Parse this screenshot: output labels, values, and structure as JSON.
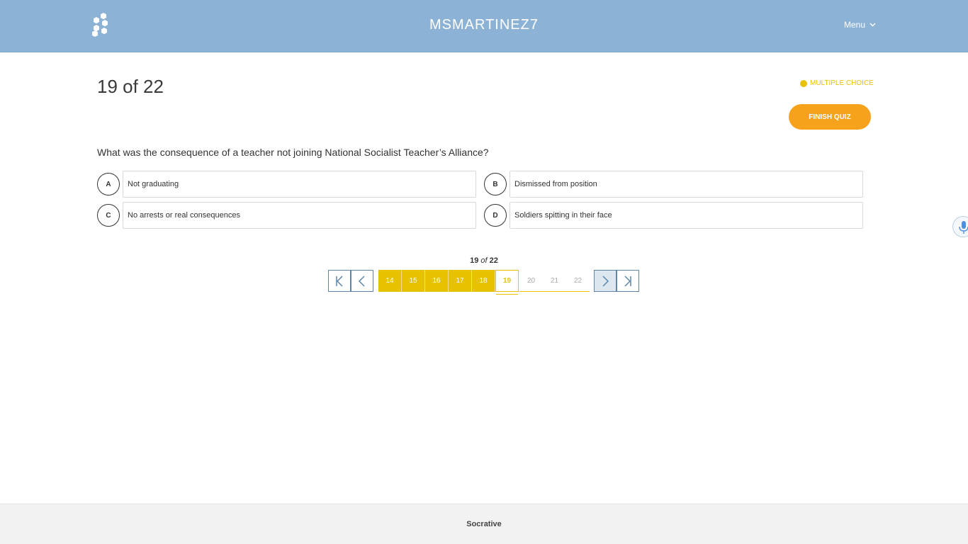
{
  "header": {
    "room_name": "MSMARTINEZ7",
    "menu_label": "Menu",
    "logo_icon": "socrative-hex-logo-icon",
    "menu_icon": "chevron-down-icon"
  },
  "quiz": {
    "progress_title": "19 of 22",
    "question_type": "MULTIPLE CHOICE",
    "finish_label": "FINISH QUIZ",
    "question": "What was the consequence of a teacher not joining National Socialist Teacher’s Alliance?",
    "answers": [
      {
        "letter": "A",
        "text": "Not graduating"
      },
      {
        "letter": "B",
        "text": "Dismissed from position"
      },
      {
        "letter": "C",
        "text": "No arrests or real consequences"
      },
      {
        "letter": "D",
        "text": "Soldiers spitting in their face"
      }
    ]
  },
  "pager": {
    "current": "19",
    "of": "of",
    "total": "22",
    "pages": [
      "14",
      "15",
      "16",
      "17",
      "18",
      "19",
      "20",
      "21",
      "22"
    ],
    "icons": {
      "first": "first-page-icon",
      "prev": "chevron-left-icon",
      "next": "chevron-right-icon",
      "last": "last-page-icon"
    }
  },
  "colors": {
    "header_bg": "#8cb3d5",
    "accent_yellow": "#e6c200",
    "finish_orange": "#f7a21b",
    "nav_border": "#5d86aa"
  },
  "footer": {
    "brand": "Socrative"
  },
  "mic_icon": "microphone-icon"
}
